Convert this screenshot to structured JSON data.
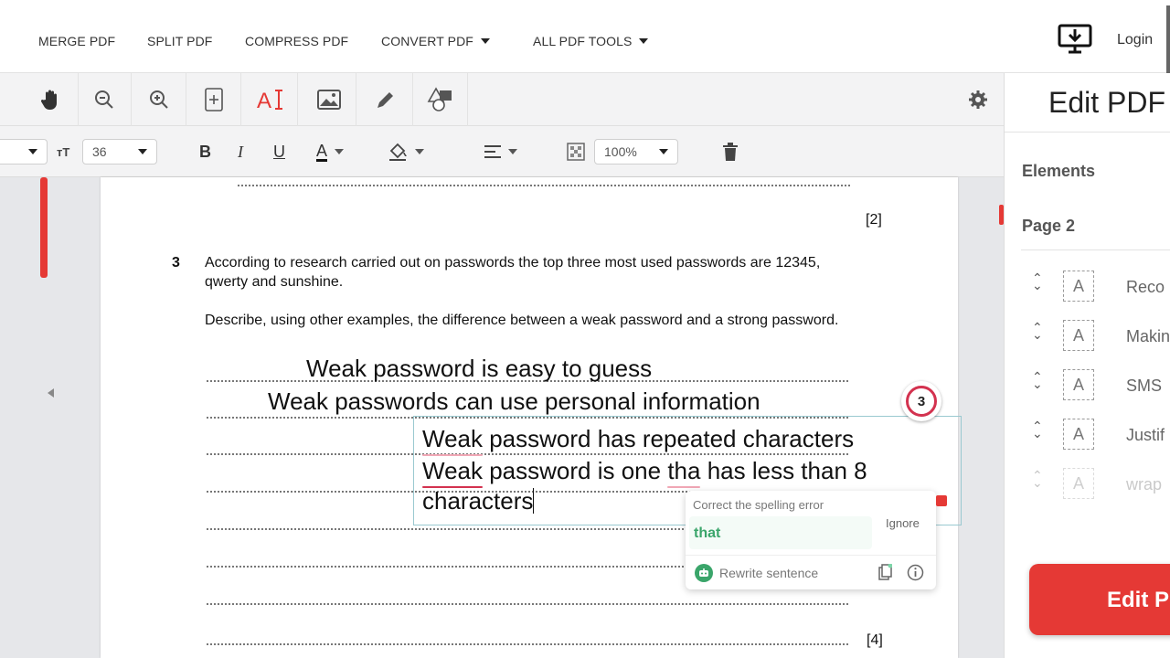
{
  "nav": {
    "items": [
      {
        "label": "MERGE PDF",
        "dropdown": false
      },
      {
        "label": "SPLIT PDF",
        "dropdown": false
      },
      {
        "label": "COMPRESS PDF",
        "dropdown": false
      },
      {
        "label": "CONVERT PDF",
        "dropdown": true
      },
      {
        "label": "ALL PDF TOOLS",
        "dropdown": true
      }
    ],
    "login_label": "Login"
  },
  "toolbar": {
    "font_size_value": "36",
    "zoom_value": "100%"
  },
  "document": {
    "prev_mark": "[2]",
    "question_number": "3",
    "question_text_line1": "According to research carried out on passwords the top three most used passwords are 12345,",
    "question_text_line2": "qwerty and sunshine.",
    "question_prompt": "Describe, using other examples, the difference between a weak password and a strong password.",
    "answer_line1": "Weak password is easy to guess",
    "answer_line2": "Weak passwords can use personal information",
    "editing_box": {
      "line1_word": "Weak",
      "line1_rest": " password has repeated characters",
      "line2_word": "Weak",
      "line2_mid": " password is one ",
      "line2_error": "tha",
      "line2_rest": " has less than 8",
      "line3": "characters"
    },
    "marks": "[4]"
  },
  "spell_badge": {
    "count": "3"
  },
  "spell_popup": {
    "heading": "Correct the spelling error",
    "suggestion": "that",
    "ignore_label": "Ignore",
    "rewrite_label": "Rewrite sentence"
  },
  "right_panel": {
    "title": "Edit PDF",
    "elements_label": "Elements",
    "page_label": "Page 2",
    "items": [
      {
        "label": "Reco"
      },
      {
        "label": "Makin"
      },
      {
        "label": "SMS"
      },
      {
        "label": "Justif"
      },
      {
        "label": "wrap"
      }
    ],
    "edit_button_label": "Edit P"
  },
  "colors": {
    "accent": "#e53935",
    "spell_underline": "#d3324f",
    "suggestion": "#3aa56a"
  }
}
